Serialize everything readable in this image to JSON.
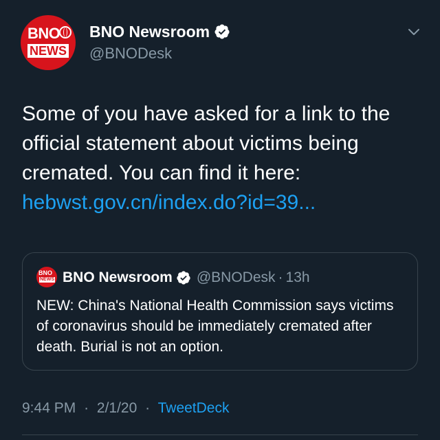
{
  "author": {
    "display_name": "BNO Newsroom",
    "handle": "@BNODesk",
    "avatar_logo_top": "BNO",
    "avatar_logo_bottom": "NEWS",
    "verified": true
  },
  "tweet": {
    "text": "Some of you have asked for a link to the official statement about victims being cremated. You can find it here:",
    "link_text": "hebwst.gov.cn/index.do?id=39..."
  },
  "quoted_tweet": {
    "display_name": "BNO Newsroom",
    "handle": "@BNODesk",
    "separator": "·",
    "time": "13h",
    "avatar_logo_top": "BNO",
    "avatar_logo_bottom": "NEWS",
    "verified": true,
    "text": "NEW: China's National Health Commission says victims of coronavirus should be immediately cremated after death. Burial is not an option."
  },
  "meta": {
    "time": "9:44 PM",
    "date": "2/1/20",
    "separator": "·",
    "source": "TweetDeck"
  },
  "colors": {
    "background": "#15202b",
    "text": "#ffffff",
    "secondary_text": "#8899a6",
    "link": "#1da1f2",
    "border": "#38444d",
    "brand_red": "#d7141c"
  },
  "icons": {
    "verified": "verified-badge-icon",
    "menu": "chevron-down-icon"
  }
}
